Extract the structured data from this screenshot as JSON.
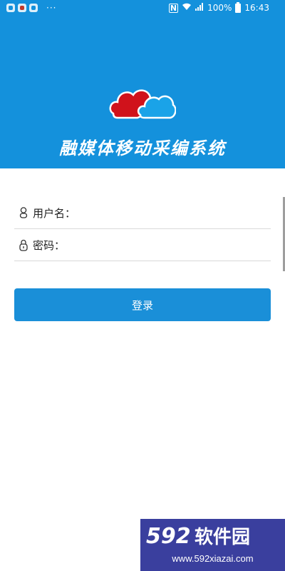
{
  "status_bar": {
    "dots": "···",
    "nfc": "N",
    "battery_percent": "100%",
    "time": "16:43",
    "icons": [
      "app-notification-icon",
      "app-notification-icon",
      "app-notification-icon",
      "nfc-icon",
      "wifi-icon",
      "signal-icon",
      "battery-icon"
    ]
  },
  "header": {
    "background_color": "#1491dc",
    "logo_colors": {
      "left_cloud": "#d0121b",
      "right_cloud": "#1aa3e8"
    },
    "app_title": "融媒体移动采编系统"
  },
  "form": {
    "username": {
      "label": "用户名：",
      "value": "",
      "icon": "user-icon"
    },
    "password": {
      "label": "密码：",
      "value": "",
      "icon": "lock-icon"
    },
    "login_button": "登录",
    "button_color": "#1a8fd8"
  },
  "watermark": {
    "brand": "592软件园",
    "url": "www.592xiazai.com"
  }
}
